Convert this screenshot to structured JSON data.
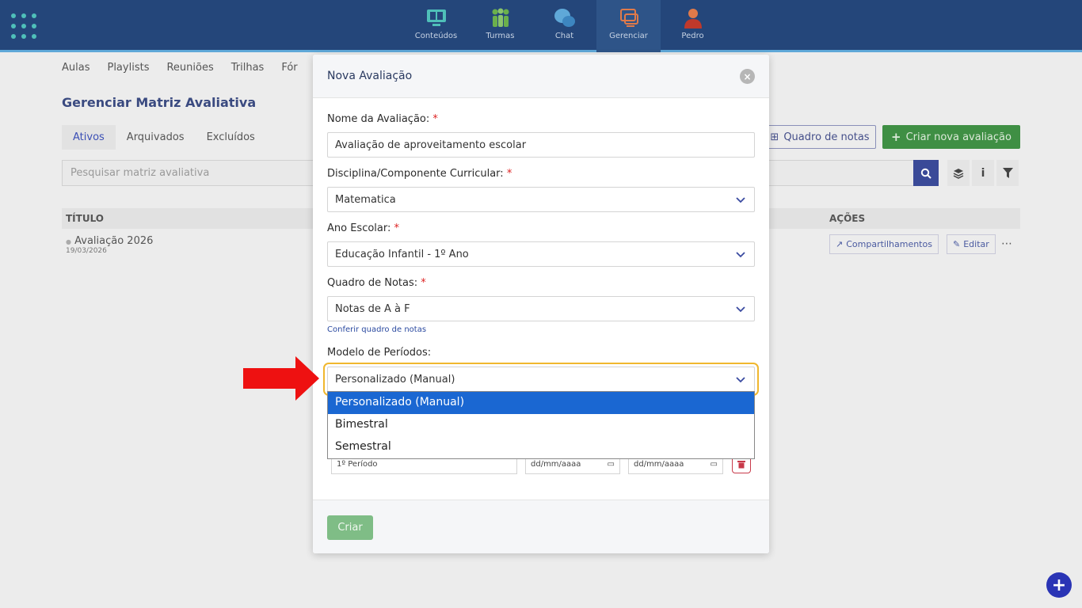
{
  "topbar": {
    "nav": [
      {
        "label": "Conteúdos",
        "icon": "monitor-book-icon",
        "color": "#4fc0b9"
      },
      {
        "label": "Turmas",
        "icon": "people-group-icon",
        "color": "#6ab04c"
      },
      {
        "label": "Chat",
        "icon": "chat-bubbles-icon",
        "color": "#5fa8d8"
      },
      {
        "label": "Gerenciar",
        "icon": "manage-screens-icon",
        "color": "#e07a4a"
      },
      {
        "label": "Pedro",
        "icon": "user-avatar-icon",
        "color": "#e07a4a"
      }
    ],
    "active": "Gerenciar"
  },
  "subnav": [
    "Aulas",
    "Playlists",
    "Reuniões",
    "Trilhas",
    "Fór"
  ],
  "page": {
    "title": "Gerenciar Matriz Avaliativa",
    "tabs": [
      "Ativos",
      "Arquivados",
      "Excluídos"
    ],
    "search_placeholder": "Pesquisar matriz avaliativa",
    "btn_quadro": "Quadro de notas",
    "btn_criar_nova": "Criar nova avaliação",
    "table": {
      "col_title": "TÍTULO",
      "col_actions": "AÇÕES",
      "rows": [
        {
          "title": "Avaliação 2026",
          "date": "19/03/2026",
          "share": "Compartilhamentos",
          "edit": "Editar"
        }
      ]
    }
  },
  "modal": {
    "title": "Nova Avaliação",
    "fields": {
      "nome": {
        "label": "Nome da Avaliação:",
        "value": "Avaliação de aproveitamento escolar"
      },
      "disciplina": {
        "label": "Disciplina/Componente Curricular:",
        "value": "Matematica"
      },
      "ano": {
        "label": "Ano Escolar:",
        "value": "Educação Infantil - 1º Ano"
      },
      "quadro": {
        "label": "Quadro de Notas:",
        "value": "Notas de A à F",
        "link": "Conferir quadro de notas"
      },
      "modelo": {
        "label": "Modelo de Períodos:",
        "value": "Personalizado (Manual)"
      }
    },
    "dropdown_options": [
      "Personalizado (Manual)",
      "Bimestral",
      "Semestral"
    ],
    "period_row": {
      "name": "1º Período",
      "date_start": "dd/mm/aaaa",
      "date_end": "dd/mm/aaaa"
    },
    "submit": "Criar",
    "required_mark": "*"
  },
  "colors": {
    "topbar": "#24467a",
    "accent": "#3a4a98",
    "focus": "#f0b72e",
    "selected_option": "#1a67d2",
    "submit": "#7fbd86",
    "arrow": "#ee1111"
  }
}
